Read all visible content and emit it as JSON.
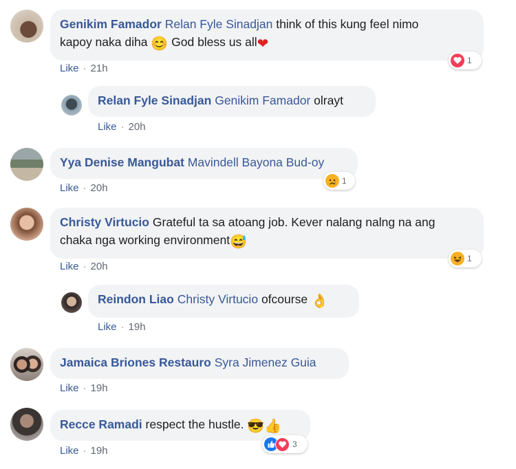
{
  "comments": [
    {
      "author": "Genikim Famador",
      "mention": "Relan Fyle Sinadjan",
      "text_line1": "think of this kung feel nimo",
      "text_line2": "kapoy naka diha",
      "text_line2_tail": "God bless us all",
      "like_label": "Like",
      "time": "21h",
      "reaction_count": "1",
      "reaction_type": "love"
    },
    {
      "author": "Relan Fyle Sinadjan",
      "mention": "Genikim Famador",
      "text": "olrayt",
      "like_label": "Like",
      "time": "20h"
    },
    {
      "author": "Yya Denise Mangubat",
      "mention": "Mavindell Bayona Bud-oy",
      "text": "",
      "like_label": "Like",
      "time": "20h",
      "reaction_count": "1",
      "reaction_type": "sad"
    },
    {
      "author": "Christy Virtucio",
      "text_line1": "Grateful ta sa atoang job. Kever nalang nalng na ang",
      "text_line2": "chaka nga working environment",
      "like_label": "Like",
      "time": "20h",
      "reaction_count": "1",
      "reaction_type": "haha"
    },
    {
      "author": "Reindon Liao",
      "mention": "Christy Virtucio",
      "text": "ofcourse",
      "like_label": "Like",
      "time": "19h"
    },
    {
      "author": "Jamaica Briones Restauro",
      "mention": "Syra Jimenez Guia",
      "text": "",
      "like_label": "Like",
      "time": "19h"
    },
    {
      "author": "Recce Ramadi",
      "text": "respect the hustle.",
      "like_label": "Like",
      "time": "19h",
      "reaction_count": "3",
      "reaction_type": "like-love"
    }
  ],
  "separator": "·",
  "colors": {
    "link": "#385898",
    "bubble": "#f2f3f5",
    "love": "#f33e58",
    "like": "#1877f2"
  }
}
